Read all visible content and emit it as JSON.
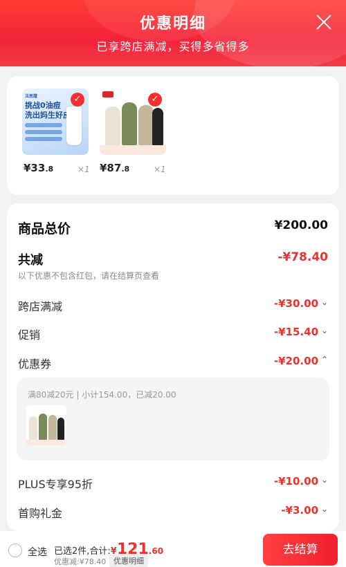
{
  "header": {
    "title": "优惠明细",
    "subtitle": "已享跨店满减，买得多省得多"
  },
  "products": [
    {
      "price_main": "¥33",
      "price_dec": ".8",
      "qty": "×1",
      "image_text": {
        "brand": "法思蔻",
        "line1": "挑战0油痘",
        "line2": "洗出妈生好皮"
      }
    },
    {
      "price_main": "¥87",
      "price_dec": ".8",
      "qty": "×1"
    }
  ],
  "summary": {
    "total_label": "商品总价",
    "total_value": "¥200.00",
    "reduce_label": "共减",
    "reduce_value": "-¥78.40",
    "note": "以下优惠不包含红包，请在结算页查看"
  },
  "discounts": [
    {
      "label": "跨店满减",
      "value": "-¥30.00",
      "chevron": "⌄"
    },
    {
      "label": "促销",
      "value": "-¥15.40",
      "chevron": "⌄"
    },
    {
      "label": "优惠券",
      "value": "-¥20.00",
      "chevron": "⌃"
    },
    {
      "label": "PLUS专享95折",
      "value": "-¥10.00",
      "chevron": "⌄"
    },
    {
      "label": "首购礼金",
      "value": "-¥3.00",
      "chevron": "⌄"
    }
  ],
  "coupon_detail": {
    "text": "满80减20元 | 小计154.00，已减20.00"
  },
  "footer": {
    "select_all": "全选",
    "summary_prefix": "已选2件,合计:",
    "currency": "¥",
    "amount_int": "121",
    "amount_dec": ".60",
    "discount_text": "优惠减:¥78.40",
    "detail_tag": "优惠明细",
    "checkout_label": "去结算"
  },
  "colors": {
    "accent": "#f2202e",
    "price_red": "#e8332f"
  }
}
